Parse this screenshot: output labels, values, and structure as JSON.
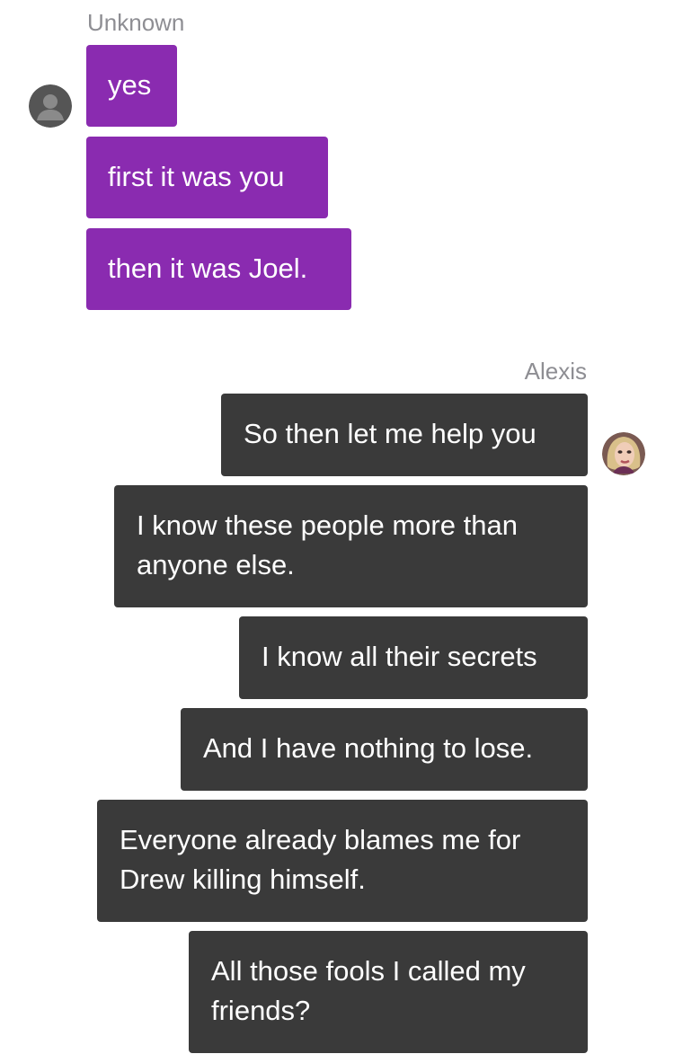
{
  "conversation": {
    "unknown": {
      "name": "Unknown",
      "avatar_icon": "default-user-icon",
      "bubble_color": "#8a2bb0",
      "messages": [
        "yes",
        "first it was you",
        "then it was Joel."
      ]
    },
    "alexis": {
      "name": "Alexis",
      "avatar_icon": "alexis-avatar",
      "bubble_color": "#3a3a3a",
      "messages": [
        [
          "So then let me help you"
        ],
        [
          "I know these people more than",
          "anyone else."
        ],
        [
          "I know all their secrets"
        ],
        [
          "And I have nothing to lose."
        ],
        [
          "Everyone already blames me for",
          "Drew killing himself."
        ],
        [
          "All those fools I called my",
          "friends?"
        ]
      ]
    }
  }
}
